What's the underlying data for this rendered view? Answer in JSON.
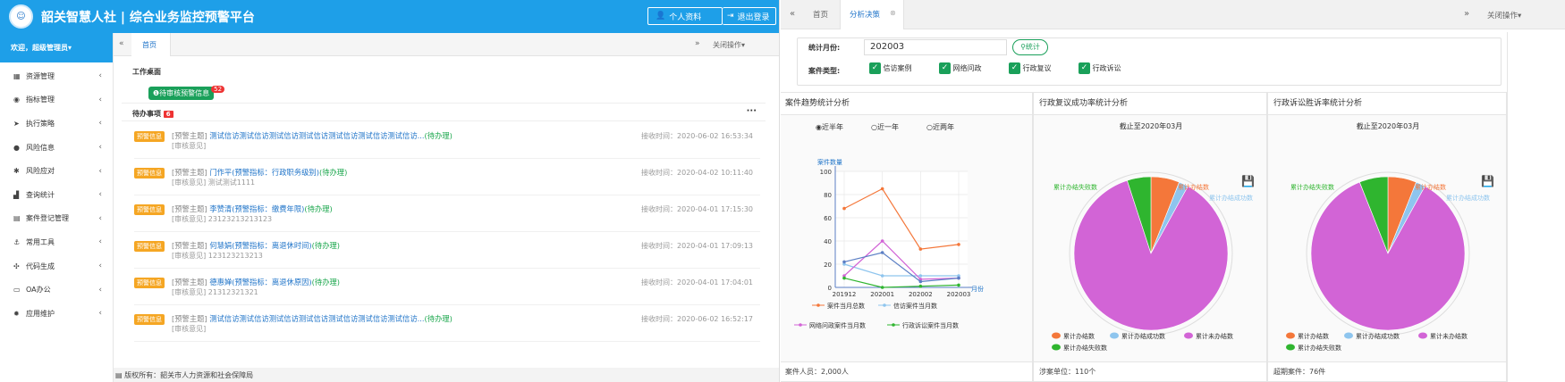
{
  "left_app": {
    "title": "韶关智慧人社 | 综合业务监控预警平台",
    "profile_btn": "个人资料",
    "logout_btn": "退出登录",
    "welcome": "欢迎，超级管理员▾",
    "menu": [
      {
        "icon": "grid-icon",
        "glyph": "▦",
        "label": "资源管理"
      },
      {
        "icon": "target-icon",
        "glyph": "◉",
        "label": "指标管理"
      },
      {
        "icon": "play-icon",
        "glyph": "➤",
        "label": "执行策略"
      },
      {
        "icon": "alert-icon",
        "glyph": "●",
        "label": "风险信息"
      },
      {
        "icon": "respond-icon",
        "glyph": "✱",
        "label": "风险应对"
      },
      {
        "icon": "chart-icon",
        "glyph": "▟",
        "label": "查询统计"
      },
      {
        "icon": "register-icon",
        "glyph": "▤",
        "label": "案件登记管理"
      },
      {
        "icon": "anchor-icon",
        "glyph": "⚓",
        "label": "常用工具"
      },
      {
        "icon": "code-icon",
        "glyph": "✣",
        "label": "代码生成"
      },
      {
        "icon": "desktop-icon",
        "glyph": "▭",
        "label": "OA办公"
      },
      {
        "icon": "settings-icon",
        "glyph": "✹",
        "label": "应用维护"
      }
    ],
    "tab_home": "首页",
    "close_ops": "关闭操作▾",
    "workbench_title": "工作桌面",
    "pending_badge": "待审核预警信息",
    "pending_count": "52",
    "todo_title": "待办事项",
    "todo_count": "6",
    "more": "···",
    "todo_items": [
      {
        "tag": "预警信息",
        "prefix": "[预警主题]",
        "link": "测试信访测试信访测试信访测试信访测试信访测试信访测试信访...",
        "status": "(待办理)",
        "sub": "[审核意见]",
        "time": "接收时间：2020-06-02 16:53:34"
      },
      {
        "tag": "预警信息",
        "prefix": "[预警主题]",
        "link": "门作平(预警指标：行政职务级别)",
        "status": "(待办理)",
        "sub": "[审核意见] 测试测试1111",
        "time": "接收时间：2020-04-02 10:11:40"
      },
      {
        "tag": "预警信息",
        "prefix": "[预警主题]",
        "link": "李赞清(预警指标：缴费年限)",
        "status": "(待办理)",
        "sub": "[审核意见] 23123213213123",
        "time": "接收时间：2020-04-01 17:15:30"
      },
      {
        "tag": "预警信息",
        "prefix": "[预警主题]",
        "link": "何慧娟(预警指标：离退休时间)",
        "status": "(待办理)",
        "sub": "[审核意见] 123123213213",
        "time": "接收时间：2020-04-01 17:09:13"
      },
      {
        "tag": "预警信息",
        "prefix": "[预警主题]",
        "link": "德惠婵(预警指标：离退休原因)",
        "status": "(待办理)",
        "sub": "[审核意见] 21312321321",
        "time": "接收时间：2020-04-01 17:04:01"
      },
      {
        "tag": "预警信息",
        "prefix": "[预警主题]",
        "link": "测试信访测试信访测试信访测试信访测试信访测试信访测试信访...",
        "status": "(待办理)",
        "sub": "[审核意见]",
        "time": "接收时间：2020-06-02 16:52:17"
      }
    ],
    "footer": "▤ 版权所有：韶关市人力资源和社会保障局"
  },
  "right_app": {
    "tab_home": "首页",
    "tab_active": "分析决策",
    "close_ops": "关闭操作▾",
    "month_label": "统计月份:",
    "month_value": "202003",
    "stat_btn": "统计",
    "case_type_label": "案件类型:",
    "case_types": [
      "信访案例",
      "网络问政",
      "行政复议",
      "行政诉讼"
    ],
    "panel1_title": "案件趋势统计分析",
    "panel2_title": "行政复议成功率统计分析",
    "panel3_title": "行政诉讼胜诉率统计分析",
    "radio_options": [
      "近半年",
      "近一年",
      "近两年"
    ],
    "panel1_foot": "案件人员：2,000人",
    "panel2_foot": "涉案单位：110个",
    "panel3_foot": "超期案件：76件",
    "pie_subtitle": "截止至2020年03月"
  },
  "chart_data": [
    {
      "type": "line",
      "ylabel": "案件数量",
      "xlabel": "月份",
      "categories": [
        "201912",
        "202001",
        "202002",
        "202003"
      ],
      "ylim": [
        0,
        100
      ],
      "yticks": [
        0,
        20,
        40,
        60,
        80,
        100
      ],
      "series": [
        {
          "name": "案件当月总数",
          "color": "#f4773a",
          "values": [
            68,
            85,
            33,
            37
          ]
        },
        {
          "name": "信访案件当月数",
          "color": "#8ec5ee",
          "values": [
            20,
            10,
            10,
            10
          ]
        },
        {
          "name": "网络问政案件当月数",
          "color": "#d264d6",
          "values": [
            10,
            40,
            7,
            8
          ]
        },
        {
          "name": "行政诉讼案件当月数",
          "color": "#2fb52f",
          "values": [
            8,
            0,
            1,
            2
          ]
        },
        {
          "name": "",
          "color": "#5b7fc4",
          "values": [
            22,
            30,
            5,
            8
          ]
        }
      ]
    },
    {
      "type": "pie",
      "series": [
        {
          "name": "累计办结数",
          "color": "#f4773a",
          "value": 6
        },
        {
          "name": "累计办结成功数",
          "color": "#8ec5ee",
          "value": 2
        },
        {
          "name": "累计未办结数",
          "color": "#d264d6",
          "value": 87
        },
        {
          "name": "累计办结失败数",
          "color": "#2fb52f",
          "value": 5
        }
      ]
    },
    {
      "type": "pie",
      "series": [
        {
          "name": "累计办结数",
          "color": "#f4773a",
          "value": 6
        },
        {
          "name": "累计办结成功数",
          "color": "#8ec5ee",
          "value": 2
        },
        {
          "name": "累计未办结数",
          "color": "#d264d6",
          "value": 86
        },
        {
          "name": "累计办结失败数",
          "color": "#2fb52f",
          "value": 6
        }
      ]
    }
  ]
}
